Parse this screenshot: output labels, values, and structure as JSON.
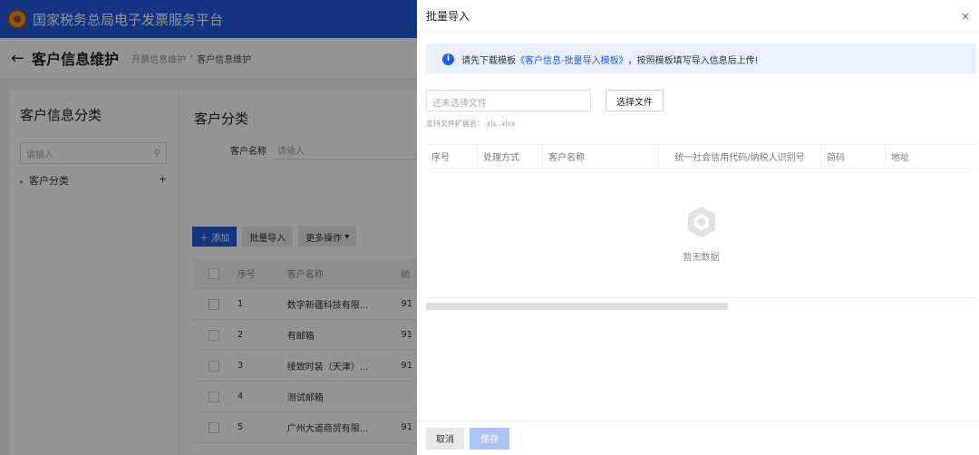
{
  "app": {
    "platform_title": "国家税务总局电子发票服务平台",
    "page_title": "客户信息维护",
    "breadcrumb": [
      "开票信息维护",
      "客户信息维护"
    ]
  },
  "left_panel": {
    "title": "客户信息分类",
    "search_placeholder": "请输入",
    "tree_item": "客户分类"
  },
  "main": {
    "title": "客户分类",
    "filter_label": "客户名称",
    "filter_placeholder": "请输入",
    "buttons": {
      "add": "添加",
      "batch_import": "批量导入",
      "more": "更多操作"
    },
    "table": {
      "headers": [
        "序号",
        "客户名称",
        "统"
      ],
      "rows": [
        {
          "seq": "1",
          "name": "数字新疆科技有限...",
          "code": "91"
        },
        {
          "seq": "2",
          "name": "有邮箱",
          "code": "91"
        },
        {
          "seq": "3",
          "name": "绫致时装（天津）...",
          "code": "91"
        },
        {
          "seq": "4",
          "name": "测试邮箱",
          "code": ""
        },
        {
          "seq": "5",
          "name": "广州大道商贸有限...",
          "code": "91"
        }
      ]
    }
  },
  "drawer": {
    "title": "批量导入",
    "close_symbol": "×",
    "alert": {
      "prefix": "请先下载模板",
      "link": "《客户信息-批量导入模板》",
      "suffix": "，按照模板填写导入信息后上传!"
    },
    "file_placeholder": "还未选择文件",
    "choose_file_label": "选择文件",
    "extension_hint": "支持文件扩展名：.xls .xlsx",
    "table_headers": [
      "序号",
      "处理方式",
      "客户名称",
      "统一社会信用代码/纳税人识别号",
      "简码",
      "地址"
    ],
    "empty_text": "暂无数据",
    "cancel_label": "取消",
    "save_label": "保存"
  },
  "colors": {
    "primary": "#1e5ce0",
    "alert_bg": "#e8f0fd",
    "disabled_primary": "#a9c4f2"
  }
}
